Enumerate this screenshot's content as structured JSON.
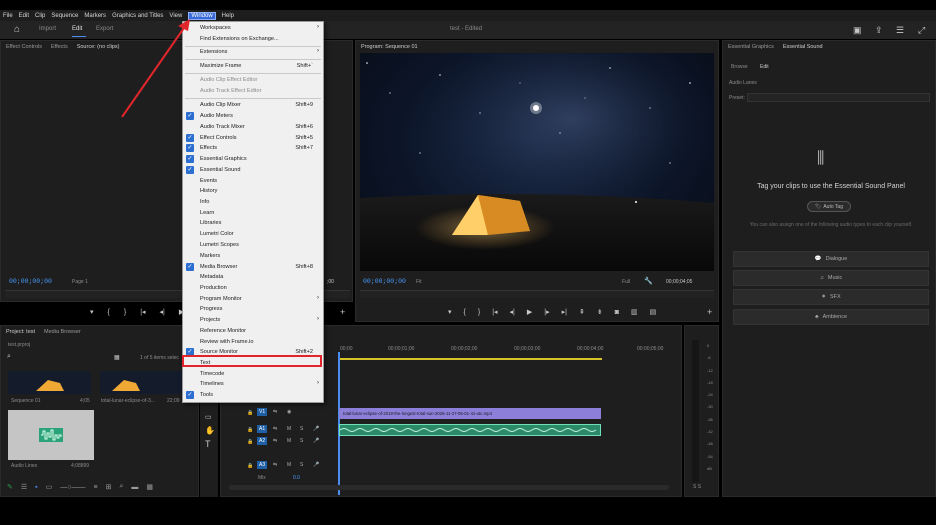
{
  "menubar": {
    "items": [
      "File",
      "Edit",
      "Clip",
      "Sequence",
      "Markers",
      "Graphics and Titles",
      "View",
      "Window",
      "Help"
    ],
    "active": "Window"
  },
  "header": {
    "tabs": [
      "Import",
      "Edit",
      "Export"
    ],
    "active_tab": "Edit",
    "title": "test",
    "title_suffix": "- Edited"
  },
  "window_menu": {
    "items": [
      {
        "label": "Workspaces",
        "submenu": true
      },
      {
        "label": "Find Extensions on Exchange..."
      },
      {
        "sep": true
      },
      {
        "label": "Extensions",
        "submenu": true
      },
      {
        "sep": true
      },
      {
        "label": "Maximize Frame",
        "shortcut": "Shift+`"
      },
      {
        "sep": true
      },
      {
        "label": "Audio Clip Effect Editor",
        "disabled": true
      },
      {
        "label": "Audio Track Effect Editor",
        "disabled": true
      },
      {
        "sep": true
      },
      {
        "label": "Audio Clip Mixer",
        "shortcut": "Shift+9"
      },
      {
        "label": "Audio Meters",
        "checked": true
      },
      {
        "label": "Audio Track Mixer",
        "shortcut": "Shift+6"
      },
      {
        "label": "Effect Controls",
        "shortcut": "Shift+5",
        "checked": true
      },
      {
        "label": "Effects",
        "shortcut": "Shift+7",
        "checked": true
      },
      {
        "label": "Essential Graphics",
        "checked": true
      },
      {
        "label": "Essential Sound",
        "checked": true
      },
      {
        "label": "Events"
      },
      {
        "label": "History"
      },
      {
        "label": "Info"
      },
      {
        "label": "Learn"
      },
      {
        "label": "Libraries"
      },
      {
        "label": "Lumetri Color"
      },
      {
        "label": "Lumetri Scopes"
      },
      {
        "label": "Markers"
      },
      {
        "label": "Media Browser",
        "shortcut": "Shift+8",
        "checked": true
      },
      {
        "label": "Metadata"
      },
      {
        "label": "Production"
      },
      {
        "label": "Program Monitor",
        "submenu": true
      },
      {
        "label": "Progress"
      },
      {
        "label": "Projects",
        "submenu": true
      },
      {
        "label": "Reference Monitor"
      },
      {
        "label": "Review with Frame.io"
      },
      {
        "label": "Source Monitor",
        "shortcut": "Shift+2",
        "checked": true
      },
      {
        "label": "Text",
        "highlighted": true
      },
      {
        "label": "Timecode"
      },
      {
        "label": "Timelines",
        "submenu": true
      },
      {
        "label": "Tools",
        "checked": true
      }
    ]
  },
  "source_panel": {
    "tabs": [
      "Effect Controls",
      "Effects",
      "Source: (no clips)"
    ],
    "timecode": "00;00;00;00",
    "page": "Page 1",
    "right_timecode": ";00"
  },
  "program_panel": {
    "title": "Program: Sequence 01",
    "timecode": "00;00;00;00",
    "fit": "Fit",
    "quality": "Full",
    "duration": "00;00;04;05"
  },
  "project_panel": {
    "tabs": [
      "Project: test",
      "Media Browser"
    ],
    "file": "test.prproj",
    "count": "1 of 5 items selec",
    "items": [
      {
        "name": "Sequence 01",
        "duration": "4;05"
      },
      {
        "name": "total-lunar-eclipse-of-3...",
        "duration": "22;09"
      },
      {
        "name": "Audio Lines",
        "duration": "4;08899"
      }
    ]
  },
  "timeline": {
    "ruler": [
      "00;00",
      "00;00;01;00",
      "00;00;02;00",
      "00;00;03;00",
      "00;00;04;00",
      "00;00;05;00"
    ],
    "clip_video": "total-lunar-eclipse-of-2018-the-longest-total-sun-2025-11-27-05-01-41-utc.mp4",
    "tracks": [
      "V1",
      "A1",
      "A2",
      "A3"
    ],
    "mix_label": "Mix",
    "mix_value": "0.0",
    "meter_scale": [
      "0",
      "-6",
      "-12",
      "-18",
      "-24",
      "-30",
      "-36",
      "-42",
      "-48",
      "-54",
      "dB"
    ],
    "meter_bottom": "S S"
  },
  "essential_sound": {
    "tabs": [
      "Essential Graphics",
      "Essential Sound"
    ],
    "subtabs": [
      "Browse",
      "Edit"
    ],
    "audio_lanes": "Audio Lanes",
    "preset_label": "Preset:",
    "heading": "Tag your clips to use the Essential Sound Panel",
    "auto_tag": "Auto Tag",
    "description": "You can also assign one of the following audio types to each clip yourself.",
    "types": [
      "Dialogue",
      "Music",
      "SFX",
      "Ambience"
    ]
  }
}
